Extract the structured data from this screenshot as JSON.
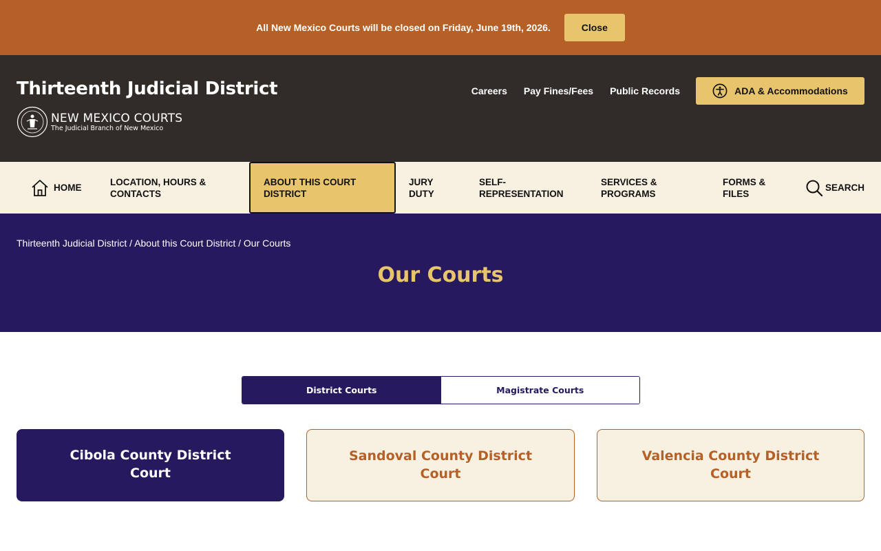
{
  "alert": {
    "message": "All New Mexico Courts will be closed on Friday, June 19th, 2026.",
    "close_label": "Close"
  },
  "header": {
    "site_title": "Thirteenth Judicial District",
    "logo_name": "NEW MEXICO COURTS",
    "logo_tagline": "The Judicial Branch of New Mexico",
    "util_links": [
      "Careers",
      "Pay Fines/Fees",
      "Public Records"
    ],
    "ada_label": "ADA & Accommodations"
  },
  "nav": {
    "items": [
      {
        "label": "HOME",
        "icon": "home-icon"
      },
      {
        "label": "LOCATION, HOURS & CONTACTS"
      },
      {
        "label": "ABOUT THIS COURT DISTRICT",
        "active": true
      },
      {
        "label": "JURY DUTY"
      },
      {
        "label": "SELF-REPRESENTATION"
      },
      {
        "label": "SERVICES & PROGRAMS"
      },
      {
        "label": "FORMS & FILES"
      },
      {
        "label": "SEARCH",
        "icon": "search-icon"
      }
    ]
  },
  "breadcrumb": {
    "items": [
      "Thirteenth Judicial District",
      "About this Court District",
      "Our Courts"
    ],
    "separator": " / "
  },
  "page": {
    "title": "Our Courts"
  },
  "tabs": [
    {
      "label": "District Courts",
      "active": true
    },
    {
      "label": "Magistrate Courts",
      "active": false
    }
  ],
  "courts": [
    {
      "name": "Cibola County District Court",
      "selected": true
    },
    {
      "name": "Sandoval County District Court",
      "selected": false
    },
    {
      "name": "Valencia County District Court",
      "selected": false
    }
  ],
  "colors": {
    "alert_bg": "#b56026",
    "header_bg": "#322c28",
    "accent_gold": "#e8c46c",
    "nav_bg": "#f8f0e0",
    "hero_bg": "#26195e"
  }
}
